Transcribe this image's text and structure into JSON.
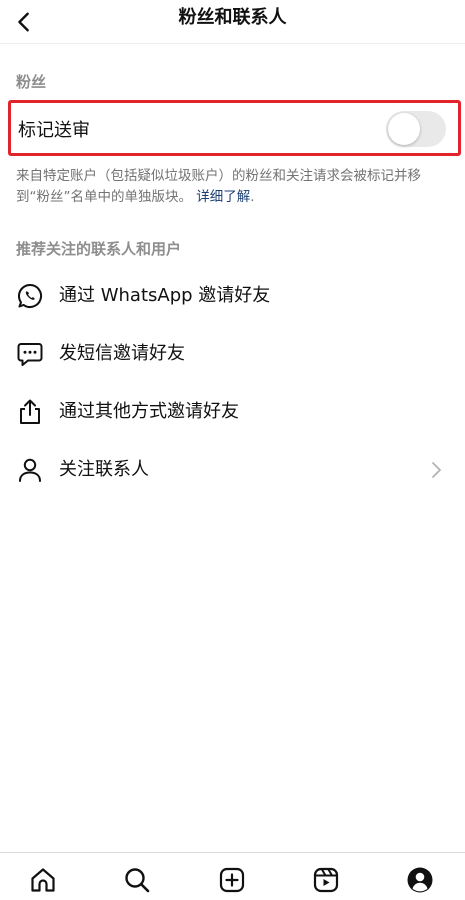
{
  "header": {
    "title": "粉丝和联系人",
    "back_icon": "chevron-left-icon"
  },
  "followers_section": {
    "label": "粉丝",
    "toggle": {
      "label": "标记送审",
      "on": false
    },
    "description": "来自特定账户（包括疑似垃圾账户）的粉丝和关注请求会被标记并移到“粉丝”名单中的单独版块。",
    "learn_more": "详细了解",
    "trailing": "."
  },
  "contacts_section": {
    "label": "推荐关注的联系人和用户",
    "items": [
      {
        "label": "通过 WhatsApp 邀请好友",
        "icon": "whatsapp-icon"
      },
      {
        "label": "发短信邀请好友",
        "icon": "message-icon"
      },
      {
        "label": "通过其他方式邀请好友",
        "icon": "share-icon"
      },
      {
        "label": "关注联系人",
        "icon": "person-icon",
        "chevron": "chevron-right-icon"
      }
    ]
  },
  "tabbar": {
    "items": [
      {
        "icon": "home-icon"
      },
      {
        "icon": "search-icon"
      },
      {
        "icon": "create-icon"
      },
      {
        "icon": "reels-icon"
      },
      {
        "icon": "profile-icon"
      }
    ]
  },
  "colors": {
    "highlight_border": "#e0242a",
    "link": "#1a3e73",
    "muted_text": "#8e8e8e"
  }
}
